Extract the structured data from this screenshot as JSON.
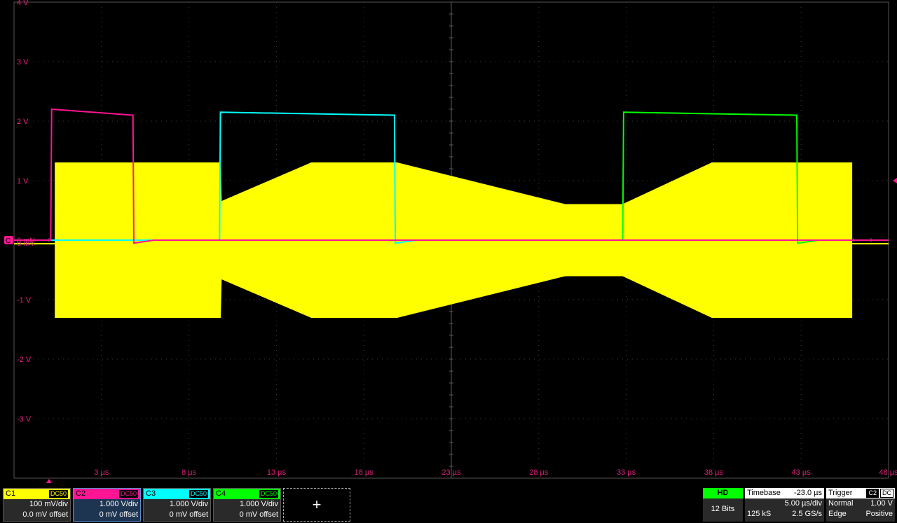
{
  "colors": {
    "c1": "#ffff00",
    "c2": "#ff1493",
    "c3": "#00ffff",
    "c4": "#00ff00",
    "grid": "#3c3c3c",
    "label": "#e0207a"
  },
  "axes": {
    "y_labels": [
      "4 V",
      "3 V",
      "2 V",
      "1 V",
      "0 mV",
      "-1 V",
      "-2 V",
      "-3 V"
    ],
    "x_labels": [
      "3 µs",
      "8 µs",
      "13 µs",
      "18 µs",
      "23 µs",
      "28 µs",
      "33 µs",
      "38 µs",
      "43 µs",
      "48 µs"
    ]
  },
  "chart_data": {
    "type": "line",
    "x": [
      -2,
      0.3,
      0.35,
      5,
      5.05,
      9.8,
      9.85,
      10,
      15,
      19.85,
      19.9,
      21,
      30,
      32.8,
      32.85,
      38,
      42.9,
      42.95,
      45,
      48
    ],
    "xlabel": "",
    "ylabel": "",
    "xlim": [
      -2,
      48
    ],
    "ylim": [
      -4,
      4
    ],
    "grid": true,
    "series": [
      {
        "name": "C1",
        "type": "envelope",
        "points": [
          {
            "t": 0.35,
            "hi": 1.3,
            "lo": -1.3
          },
          {
            "t": 9.8,
            "hi": 1.3,
            "lo": -1.3
          },
          {
            "t": 9.85,
            "hi": 0.65,
            "lo": -0.65
          },
          {
            "t": 15,
            "hi": 1.3,
            "lo": -1.3
          },
          {
            "t": 19.9,
            "hi": 1.3,
            "lo": -1.3
          },
          {
            "t": 29.5,
            "hi": 0.6,
            "lo": -0.6
          },
          {
            "t": 32.8,
            "hi": 0.6,
            "lo": -0.6
          },
          {
            "t": 37.9,
            "hi": 1.3,
            "lo": -1.3
          },
          {
            "t": 45.9,
            "hi": 1.3,
            "lo": -1.3
          }
        ]
      },
      {
        "name": "C2",
        "points": [
          {
            "t": -2,
            "v": 0
          },
          {
            "t": 0.1,
            "v": 0
          },
          {
            "t": 0.15,
            "v": 2.2
          },
          {
            "t": 4.8,
            "v": 2.1
          },
          {
            "t": 4.85,
            "v": -0.05
          },
          {
            "t": 6,
            "v": 0
          },
          {
            "t": 48,
            "v": 0
          }
        ]
      },
      {
        "name": "C3",
        "points": [
          {
            "t": -2,
            "v": 0
          },
          {
            "t": 9.75,
            "v": 0
          },
          {
            "t": 9.8,
            "v": 2.15
          },
          {
            "t": 19.75,
            "v": 2.1
          },
          {
            "t": 19.8,
            "v": -0.05
          },
          {
            "t": 21,
            "v": 0
          },
          {
            "t": 48,
            "v": 0
          }
        ]
      },
      {
        "name": "C4",
        "points": [
          {
            "t": -2,
            "v": 0
          },
          {
            "t": 32.8,
            "v": 0
          },
          {
            "t": 32.85,
            "v": 2.15
          },
          {
            "t": 42.75,
            "v": 2.1
          },
          {
            "t": 42.8,
            "v": -0.05
          },
          {
            "t": 44,
            "v": 0
          },
          {
            "t": 48,
            "v": 0
          }
        ]
      }
    ]
  },
  "channels": [
    {
      "name": "C1",
      "coupling": "DC50",
      "scale": "100 mV/div",
      "offset": "0.0 mV offset",
      "color": "#ffff00"
    },
    {
      "name": "C2",
      "coupling": "DC50",
      "scale": "1.000 V/div",
      "offset": "0 mV offset",
      "color": "#ff1493"
    },
    {
      "name": "C3",
      "coupling": "DC50",
      "scale": "1.000 V/div",
      "offset": "0 mV offset",
      "color": "#00ffff"
    },
    {
      "name": "C4",
      "coupling": "DC50",
      "scale": "1.000 V/div",
      "offset": "0 mV offset",
      "color": "#00ff00"
    }
  ],
  "add_button": "+",
  "acquisition": {
    "mode": "HD",
    "bits": "12 Bits"
  },
  "timebase": {
    "title": "Timebase",
    "delay": "-23.0 µs",
    "scale": "5.00 µs/div",
    "samples": "125 kS",
    "rate": "2.5 GS/s"
  },
  "trigger": {
    "title": "Trigger",
    "source": "C2",
    "coupling": "DC",
    "mode": "Normal",
    "level": "1.00 V",
    "type": "Edge",
    "slope": "Positive"
  },
  "markers": {
    "ground_label": "C",
    "ground_value": "0 mV"
  }
}
